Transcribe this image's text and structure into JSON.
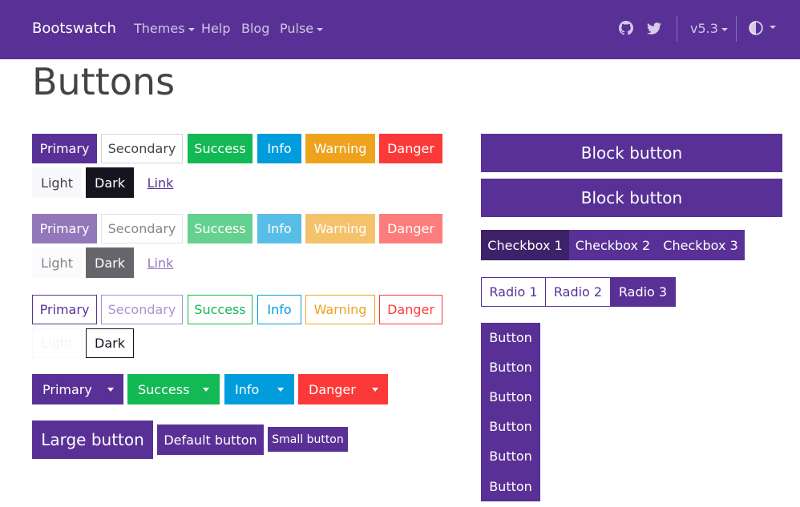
{
  "navbar": {
    "brand": "Bootswatch",
    "links": [
      "Themes",
      "Help",
      "Blog",
      "Pulse"
    ],
    "version": "v5.3",
    "icons": [
      "github-icon",
      "twitter-icon",
      "theme-toggle-icon"
    ]
  },
  "page": {
    "title": "Buttons"
  },
  "colors": {
    "primary": "#593196",
    "secondary": "#a991d4",
    "success": "#13b955",
    "info": "#009cdc",
    "warning": "#efa31d",
    "danger": "#fc3939",
    "light": "#f9f8fc",
    "dark": "#17141f"
  },
  "button_rows": {
    "labels": [
      "Primary",
      "Secondary",
      "Success",
      "Info",
      "Warning",
      "Danger",
      "Light",
      "Dark",
      "Link"
    ],
    "outline_labels": [
      "Primary",
      "Secondary",
      "Success",
      "Info",
      "Warning",
      "Danger",
      "Light",
      "Dark"
    ]
  },
  "split_buttons": [
    "Primary",
    "Success",
    "Info",
    "Danger"
  ],
  "sizes": {
    "large": "Large button",
    "default": "Default button",
    "small": "Small button"
  },
  "block_buttons": [
    "Block button",
    "Block button"
  ],
  "checkbox_group": [
    "Checkbox 1",
    "Checkbox 2",
    "Checkbox 3"
  ],
  "radio_group": [
    "Radio 1",
    "Radio 2",
    "Radio 3"
  ],
  "vertical_group": [
    "Button",
    "Button",
    "Button",
    "Button",
    "Button",
    "Button"
  ]
}
